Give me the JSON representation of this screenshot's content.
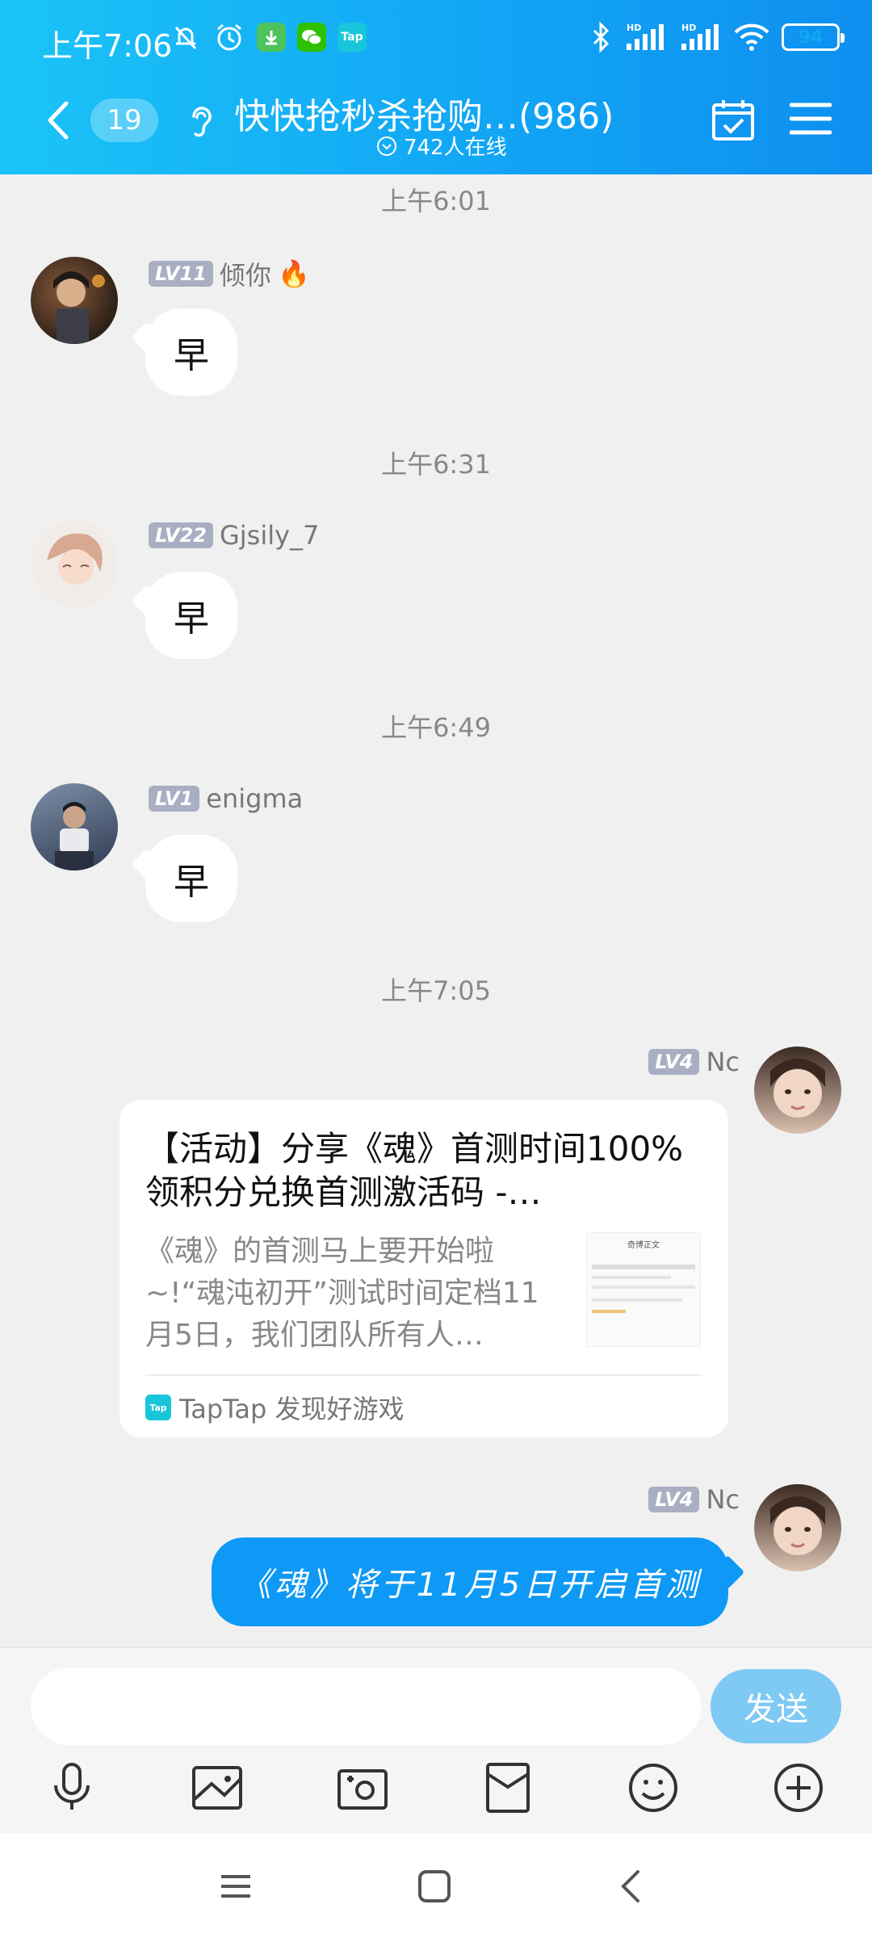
{
  "status_bar": {
    "time": "上午7:06",
    "left_icons": [
      "mute-bell-icon",
      "alarm-icon",
      "download-app-icon",
      "wechat-icon",
      "taptap-icon"
    ],
    "taptap_label": "Tap",
    "right_icons": [
      "bluetooth-icon",
      "signal-hd-icon",
      "signal-hd-icon",
      "wifi-icon"
    ],
    "battery": "94",
    "battery_level": 0.94
  },
  "header": {
    "unread_count": "19",
    "group_title": "快快抢秒杀抢购…(986)",
    "online_text": "742人在线"
  },
  "messages": [
    {
      "time": "上午6:01",
      "level": "LV11",
      "name": "倾你",
      "badge": "🔥",
      "text": "早"
    },
    {
      "time": "上午6:31",
      "level": "LV22",
      "name": "Gjsily_7",
      "text": "早"
    },
    {
      "time": "上午6:49",
      "level": "LV1",
      "name": "enigma",
      "text": "早"
    }
  ],
  "self_messages": {
    "time": "上午7:05",
    "card": {
      "level": "LV4",
      "name": "Nc",
      "title": "【活动】分享《魂》首测时间100%领积分兑换首测激活码 -…",
      "desc": "《魂》的首测马上要开始啦~!“魂沌初开”测试时间定档11月5日，我们团队所有人…",
      "source": "TapTap 发现好游戏",
      "source_icon": "Tap",
      "thumb_title": "奇博正文"
    },
    "text_msg": {
      "level": "LV4",
      "name": "Nc",
      "text": "《魂》将于11月5日开启首测"
    }
  },
  "input": {
    "placeholder": "",
    "send_label": "发送"
  },
  "colors": {
    "header_start": "#1bc4f7",
    "header_end": "#0e8ff0",
    "self_bubble": "#0d99f5",
    "send_button": "#7fc9f5"
  }
}
